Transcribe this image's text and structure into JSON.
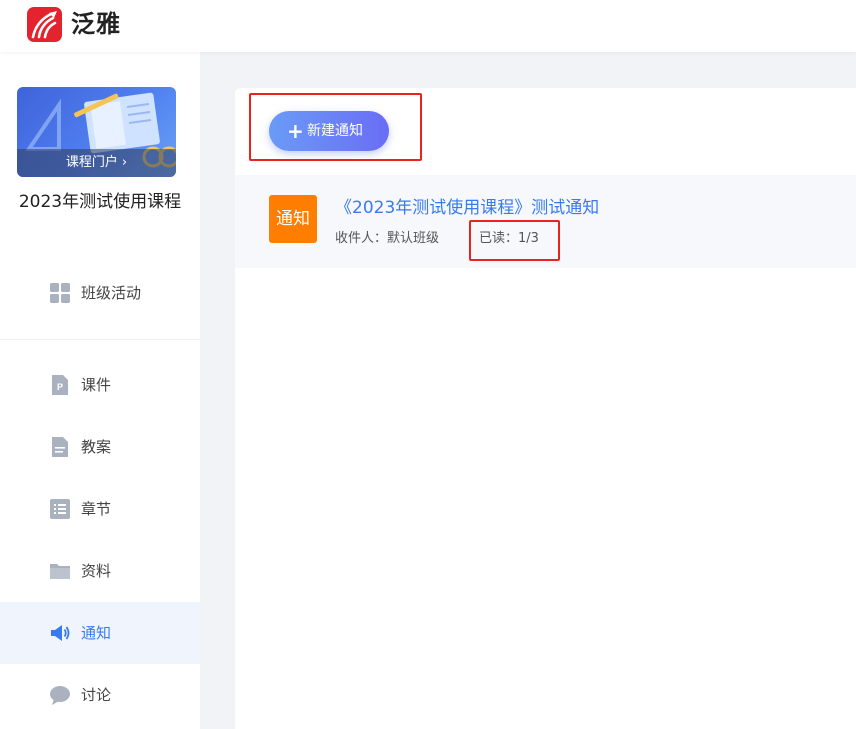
{
  "header": {
    "brand": "泛雅",
    "accent": "#e3232d"
  },
  "sidebar": {
    "cover_label": "课程门户",
    "cover_chevron": "›",
    "course_title": "2023年测试使用课程",
    "items": [
      {
        "label": "班级活动",
        "icon": "grid-icon",
        "active": false
      },
      {
        "label": "课件",
        "icon": "ppt-file-icon",
        "active": false
      },
      {
        "label": "教案",
        "icon": "lesson-plan-icon",
        "active": false
      },
      {
        "label": "章节",
        "icon": "list-icon",
        "active": false
      },
      {
        "label": "资料",
        "icon": "folder-icon",
        "active": false
      },
      {
        "label": "通知",
        "icon": "speaker-icon",
        "active": true
      },
      {
        "label": "讨论",
        "icon": "chat-bubble-icon",
        "active": false
      }
    ]
  },
  "main": {
    "new_button_label": "新建通知",
    "notice": {
      "badge": "通知",
      "title": "《2023年测试使用课程》测试通知",
      "recipient": "收件人：默认班级",
      "read": "已读：1/3"
    }
  },
  "colors": {
    "active": "#3a7af0",
    "badge": "#ff7d00",
    "highlight": "#e8241d"
  }
}
